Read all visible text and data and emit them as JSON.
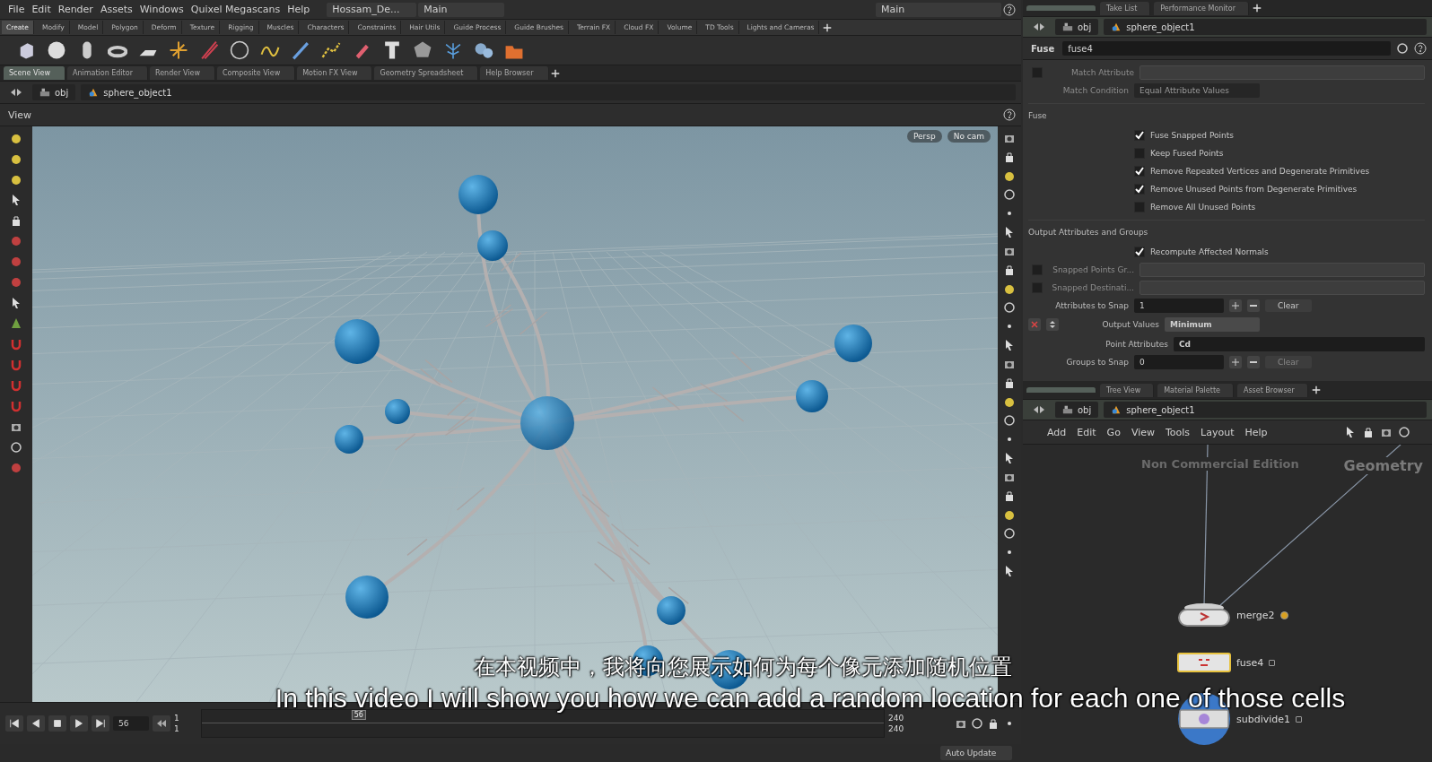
{
  "menu_bar": {
    "items": [
      "File",
      "Edit",
      "Render",
      "Assets",
      "Windows",
      "Quixel Megascans",
      "Help"
    ],
    "desktop_name": "Hossam_De...",
    "desktop": "Main",
    "right_desktop": "Main"
  },
  "shelf_tabs": [
    {
      "label": "Create",
      "selected": true
    },
    {
      "label": "Modify",
      "selected": false
    },
    {
      "label": "Model",
      "selected": false
    },
    {
      "label": "Polygon",
      "selected": false
    },
    {
      "label": "Deform",
      "selected": false
    },
    {
      "label": "Texture",
      "selected": false
    },
    {
      "label": "Rigging",
      "selected": false
    },
    {
      "label": "Muscles",
      "selected": false
    },
    {
      "label": "Characters",
      "selected": false
    },
    {
      "label": "Constraints",
      "selected": false
    },
    {
      "label": "Hair Utils",
      "selected": false
    },
    {
      "label": "Guide Process",
      "selected": false
    },
    {
      "label": "Guide Brushes",
      "selected": false
    },
    {
      "label": "Terrain FX",
      "selected": false
    },
    {
      "label": "Cloud FX",
      "selected": false
    },
    {
      "label": "Volume",
      "selected": false
    },
    {
      "label": "TD Tools",
      "selected": false
    },
    {
      "label": "Lights and Cameras",
      "selected": false
    }
  ],
  "pane_tabs": [
    {
      "label": "Scene View",
      "selected": true
    },
    {
      "label": "Animation Editor",
      "selected": false
    },
    {
      "label": "Render View",
      "selected": false
    },
    {
      "label": "Composite View",
      "selected": false
    },
    {
      "label": "Motion FX View",
      "selected": false
    },
    {
      "label": "Geometry Spreadsheet",
      "selected": false
    },
    {
      "label": "Help Browser",
      "selected": false
    }
  ],
  "path_bar": {
    "network": "obj",
    "node": "sphere_object1"
  },
  "viewport": {
    "title": "View",
    "buttons": [
      "Persp",
      "No cam"
    ]
  },
  "timeline": {
    "frame": "56",
    "range_start": "1",
    "range_start_2": "1",
    "range_end": "240",
    "range_end_2": "240",
    "marker": "56",
    "level": 0.23
  },
  "status_bar": {
    "update_mode": "Auto Update"
  },
  "parameter_pane": {
    "tabs": [
      {
        "selected": true
      },
      {
        "label": "Take List",
        "selected": false
      },
      {
        "label": "Performance Monitor",
        "selected": false
      }
    ],
    "path": {
      "network": "obj",
      "node": "sphere_object1"
    },
    "node_type": "Fuse",
    "node_name": "fuse4",
    "params": [
      {
        "kind": "field",
        "label": "Match Attribute",
        "disabled": true,
        "toggle": false
      },
      {
        "kind": "dropdown",
        "label": "Match Condition",
        "value": "Equal Attribute Values",
        "disabled": true
      },
      {
        "kind": "section",
        "label": "Fuse"
      },
      {
        "kind": "checkbox",
        "label": "Fuse Snapped Points",
        "checked": true
      },
      {
        "kind": "checkbox",
        "label": "Keep Fused Points",
        "checked": false
      },
      {
        "kind": "checkbox",
        "label": "Remove Repeated Vertices and Degenerate Primitives",
        "checked": true
      },
      {
        "kind": "checkbox",
        "label": "Remove Unused Points from Degenerate Primitives",
        "checked": true
      },
      {
        "kind": "checkbox",
        "label": "Remove All Unused Points",
        "checked": false
      },
      {
        "kind": "section",
        "label": "Output Attributes and Groups"
      },
      {
        "kind": "checkbox",
        "label": "Recompute Affected Normals",
        "checked": true
      },
      {
        "kind": "field",
        "label": "Snapped Points Gr...",
        "disabled": true,
        "toggle": false
      },
      {
        "kind": "field",
        "label": "Snapped Destinati...",
        "disabled": true,
        "toggle": false
      },
      {
        "kind": "multiparm",
        "label": "Attributes to Snap",
        "value": "1",
        "clear": "Clear",
        "disabled": false
      },
      {
        "kind": "instance_dropdown",
        "label": "Output Values",
        "value": "Minimum"
      },
      {
        "kind": "attribute_field",
        "label": "Point Attributes",
        "value": "Cd"
      },
      {
        "kind": "multiparm",
        "label": "Groups to Snap",
        "value": "0",
        "clear": "Clear",
        "disabled": true
      }
    ]
  },
  "network_pane": {
    "tabs": [
      {
        "selected": true
      },
      {
        "label": "Tree View",
        "selected": false
      },
      {
        "label": "Material Palette",
        "selected": false
      },
      {
        "label": "Asset Browser",
        "selected": false
      }
    ],
    "path": {
      "network": "obj",
      "node": "sphere_object1"
    },
    "menu": [
      "Add",
      "Edit",
      "Go",
      "View",
      "Tools",
      "Layout",
      "Help"
    ],
    "edition_label": "Non Commercial Edition",
    "context_label": "Geometry",
    "nodes": [
      {
        "kind": "merge",
        "name": "merge2",
        "selected": false,
        "warning": true
      },
      {
        "kind": "fuse",
        "name": "fuse4",
        "selected": true,
        "warning": false
      },
      {
        "kind": "subdivide",
        "name": "subdivide1",
        "selected": false,
        "warning": false
      }
    ]
  },
  "subtitles": [
    "在本视频中，我将向您展示如何为每个像元添加随机位置",
    "In this video I will show you how we can add a random location for each one of those cells"
  ]
}
